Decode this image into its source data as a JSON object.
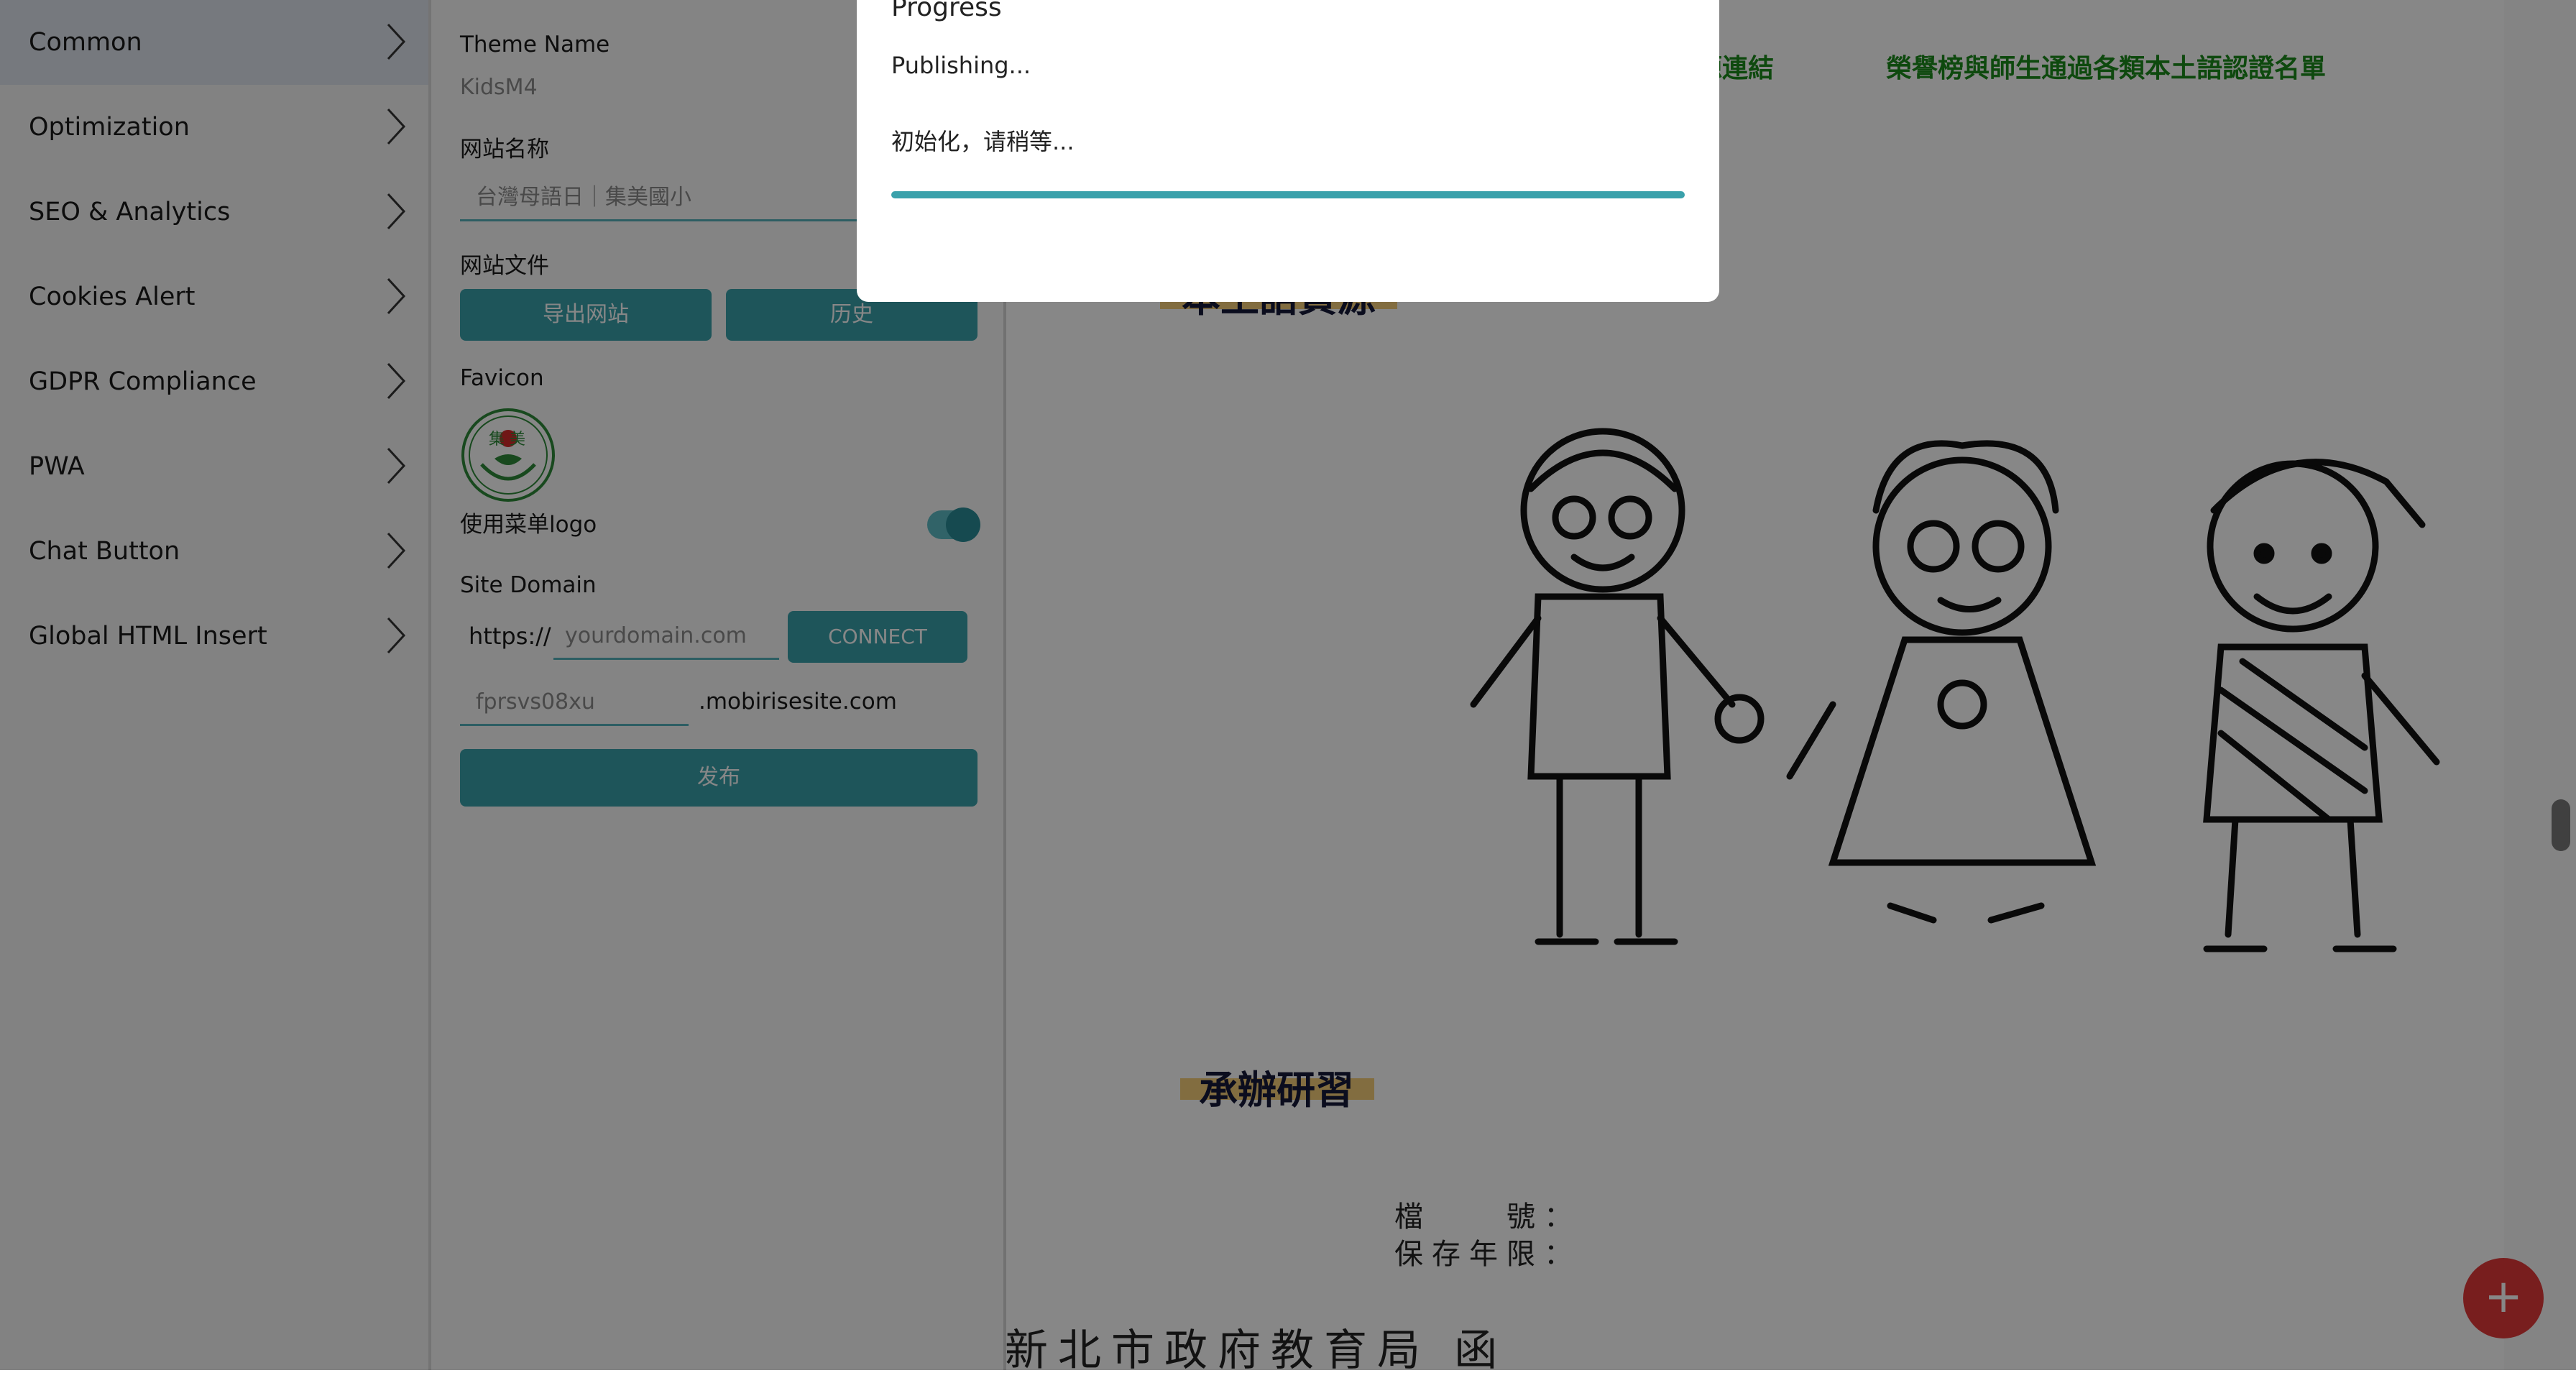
{
  "sidebar": {
    "items": [
      {
        "label": "Common"
      },
      {
        "label": "Optimization"
      },
      {
        "label": "SEO & Analytics"
      },
      {
        "label": "Cookies Alert"
      },
      {
        "label": "GDPR Compliance"
      },
      {
        "label": "PWA"
      },
      {
        "label": "Chat Button"
      },
      {
        "label": "Global HTML Insert"
      }
    ]
  },
  "settings": {
    "theme_name_label": "Theme Name",
    "theme_name_value": "KidsM4",
    "site_name_label": "网站名称",
    "site_name_value": "台灣母語日｜集美國小",
    "site_files_label": "网站文件",
    "export_button": "导出网站",
    "history_button": "历史",
    "favicon_label": "Favicon",
    "favicon_text": "集 美",
    "menu_logo_label": "使用菜单logo",
    "menu_logo_enabled": true,
    "site_domain_label": "Site Domain",
    "protocol": "https://",
    "domain_placeholder": "yourdomain.com",
    "connect_button": "CONNECT",
    "subdomain_value": "fprsvs08xu",
    "subdomain_suffix": ".mobirisesite.com",
    "publish_button": "发布"
  },
  "preview": {
    "nav_links": [
      "資源連結",
      "榮譽榜與師生通過各類本土語認證名單"
    ],
    "partial_heading": "本土語資源",
    "heading": "承辦研習",
    "doc_line1": "檔　　號：",
    "doc_line2": "保存年限：",
    "doc_title": "新北市政府教育局 函"
  },
  "modal": {
    "title": "Progress",
    "status": "Publishing...",
    "sub_status": "初始化，请稍等...",
    "progress": 1.0
  },
  "colors": {
    "accent": "#3aa1ab",
    "fab": "#e23a3a",
    "nav_link": "#1b8a1b"
  }
}
